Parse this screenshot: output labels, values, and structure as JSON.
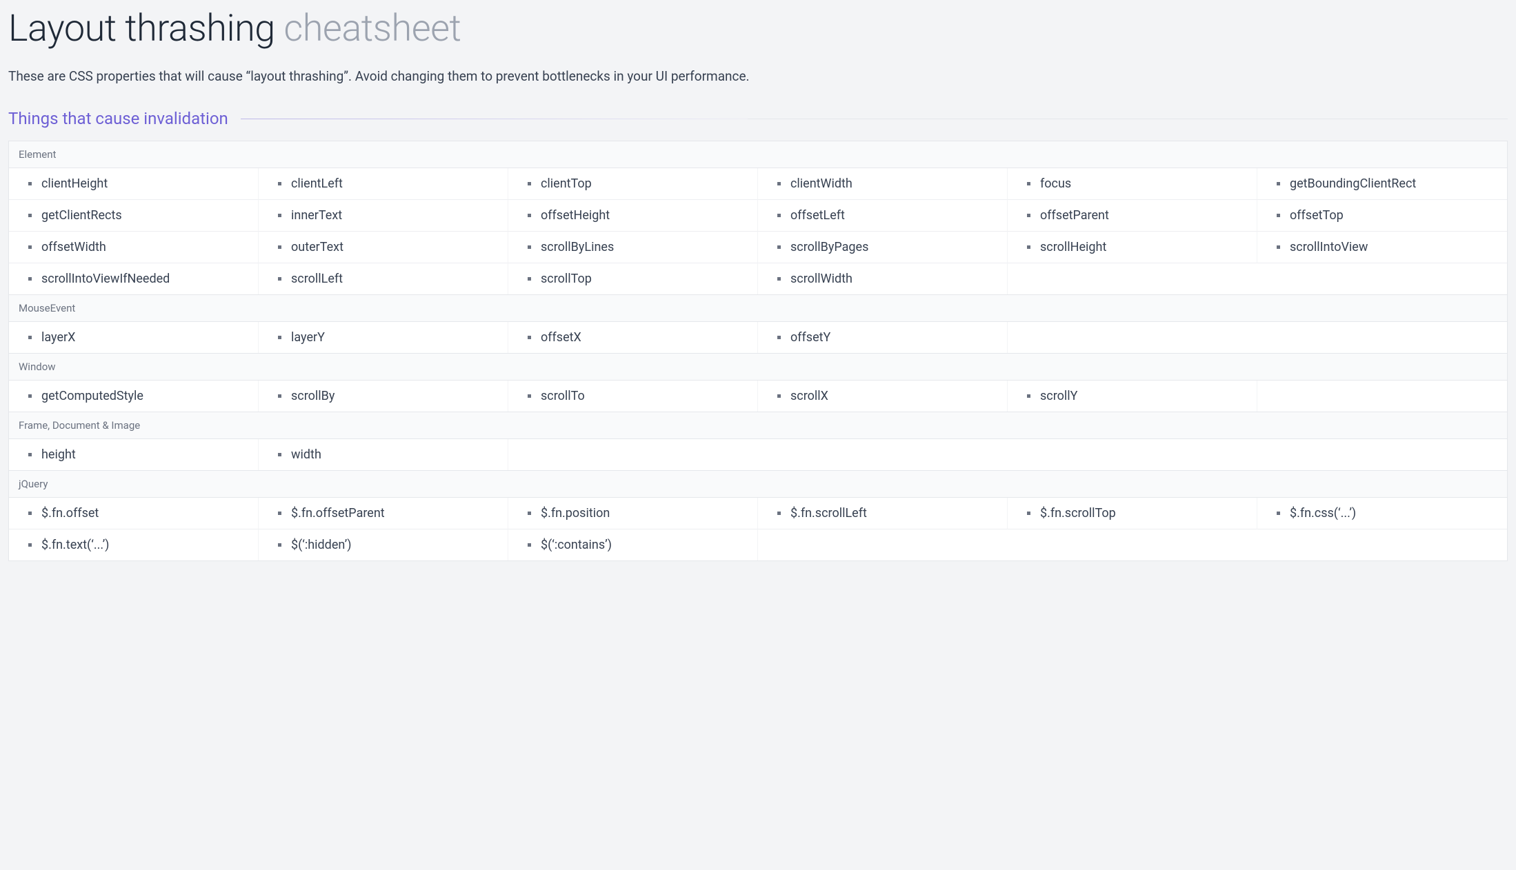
{
  "title": {
    "main": "Layout thrashing",
    "suffix": "cheatsheet"
  },
  "intro": "These are CSS properties that will cause “layout thrashing”. Avoid changing them to prevent bottlenecks in your UI performance.",
  "section_heading": "Things that cause invalidation",
  "groups": [
    {
      "label": "Element",
      "items": [
        "clientHeight",
        "clientLeft",
        "clientTop",
        "clientWidth",
        "focus",
        "getBoundingClientRect",
        "getClientRects",
        "innerText",
        "offsetHeight",
        "offsetLeft",
        "offsetParent",
        "offsetTop",
        "offsetWidth",
        "outerText",
        "scrollByLines",
        "scrollByPages",
        "scrollHeight",
        "scrollIntoView",
        "scrollIntoViewIfNeeded",
        "scrollLeft",
        "scrollTop",
        "scrollWidth"
      ]
    },
    {
      "label": "MouseEvent",
      "items": [
        "layerX",
        "layerY",
        "offsetX",
        "offsetY"
      ]
    },
    {
      "label": "Window",
      "items": [
        "getComputedStyle",
        "scrollBy",
        "scrollTo",
        "scrollX",
        "scrollY"
      ]
    },
    {
      "label": "Frame, Document & Image",
      "items": [
        "height",
        "width"
      ]
    },
    {
      "label": "jQuery",
      "items": [
        "$.fn.offset",
        "$.fn.offsetParent",
        "$.fn.position",
        "$.fn.scrollLeft",
        "$.fn.scrollTop",
        "$.fn.css(‘...’)",
        "$.fn.text(‘...’)",
        "$(‘:hidden’)",
        "$(‘:contains’)"
      ]
    }
  ]
}
